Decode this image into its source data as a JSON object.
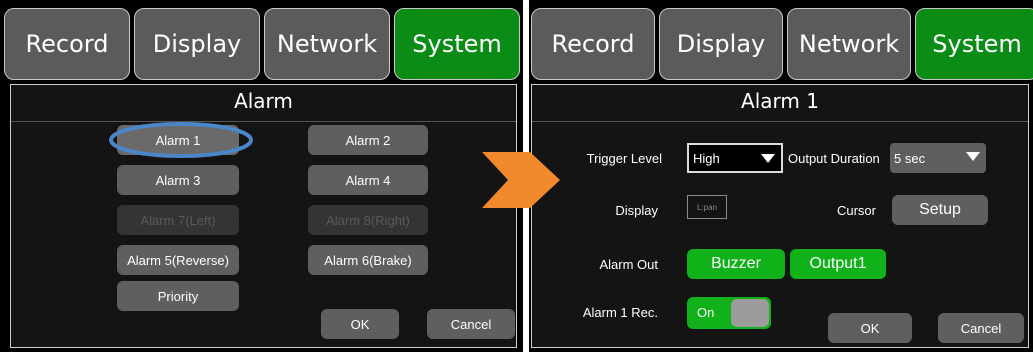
{
  "tabs": [
    "Record",
    "Display",
    "Network",
    "System"
  ],
  "left": {
    "title": "Alarm",
    "buttons": {
      "alarm1": "Alarm 1",
      "alarm2": "Alarm 2",
      "alarm3": "Alarm 3",
      "alarm4": "Alarm 4",
      "alarm7": "Alarm 7(Left)",
      "alarm8": "Alarm 8(Right)",
      "alarm5": "Alarm 5(Reverse)",
      "alarm6": "Alarm 6(Brake)",
      "priority": "Priority",
      "ok": "OK",
      "cancel": "Cancel"
    }
  },
  "right": {
    "title": "Alarm 1",
    "trigger_level_label": "Trigger Level",
    "trigger_level_value": "High",
    "output_duration_label": "Output Duration",
    "output_duration_value": "5 sec",
    "display_label": "Display",
    "display_value": "L:pan",
    "cursor_label": "Cursor",
    "setup_label": "Setup",
    "alarm_out_label": "Alarm Out",
    "buzzer_label": "Buzzer",
    "output1_label": "Output1",
    "alarm_rec_label": "Alarm 1 Rec.",
    "toggle_label": "On",
    "ok": "OK",
    "cancel": "Cancel"
  },
  "colors": {
    "active_tab": "#0a8c16",
    "green_button": "#11b119",
    "highlight_ring": "#4a86c8",
    "arrow": "#f08a2c"
  },
  "icons": [
    "dropdown-arrow-icon",
    "next-step-arrow-icon"
  ]
}
